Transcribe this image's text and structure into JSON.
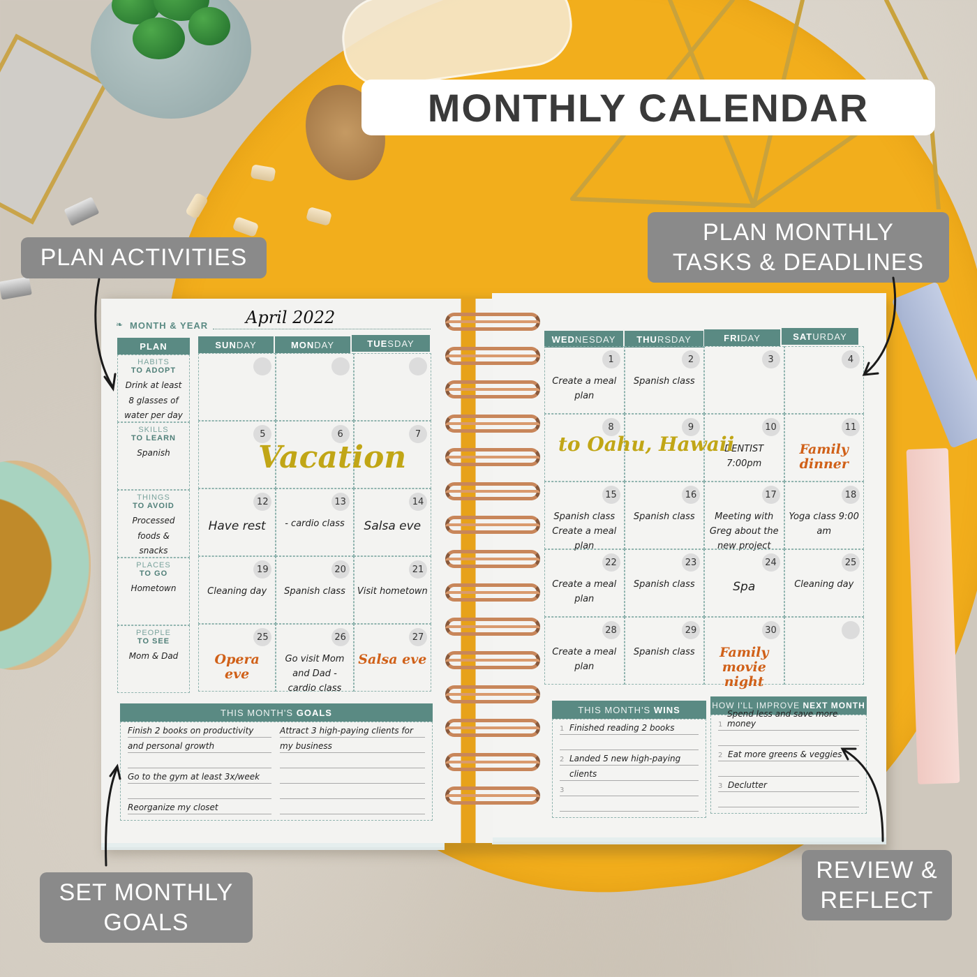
{
  "title": "MONTHLY CALENDAR",
  "callouts": {
    "plan_activities": "PLAN ACTIVITIES",
    "plan_monthly_line1": "PLAN MONTHLY",
    "plan_monthly_line2": "TASKS & DEADLINES",
    "set_goals_line1": "SET MONTHLY",
    "set_goals_line2": "GOALS",
    "review_line1": "REVIEW &",
    "review_line2": "REFLECT"
  },
  "planner": {
    "month_label": "MONTH & YEAR",
    "month_value": "April 2022",
    "plan_header": "PLAN",
    "plan": [
      {
        "category": "HABITS",
        "sub": "TO ADOPT",
        "value": "Drink at least 8 glasses of water per day"
      },
      {
        "category": "SKILLS",
        "sub": "TO LEARN",
        "value": "Spanish"
      },
      {
        "category": "THINGS",
        "sub": "TO AVOID",
        "value": "Processed foods & snacks"
      },
      {
        "category": "PLACES",
        "sub": "TO GO",
        "value": "Hometown"
      },
      {
        "category": "PEOPLE",
        "sub": "TO SEE",
        "value": "Mom & Dad"
      }
    ],
    "days": [
      {
        "bold": "SUN",
        "rest": "DAY"
      },
      {
        "bold": "MON",
        "rest": "DAY"
      },
      {
        "bold": "TUE",
        "rest": "SDAY"
      },
      {
        "bold": "WED",
        "rest": "NESDAY"
      },
      {
        "bold": "THU",
        "rest": "RSDAY"
      },
      {
        "bold": "FRI",
        "rest": "DAY"
      },
      {
        "bold": "SAT",
        "rest": "URDAY"
      }
    ],
    "weeks": [
      [
        {
          "n": "",
          "t": ""
        },
        {
          "n": "",
          "t": ""
        },
        {
          "n": "",
          "t": ""
        },
        {
          "n": "1",
          "t": "Create a meal plan"
        },
        {
          "n": "2",
          "t": "Spanish class"
        },
        {
          "n": "3",
          "t": ""
        },
        {
          "n": "4",
          "t": ""
        }
      ],
      [
        {
          "n": "5",
          "t": ""
        },
        {
          "n": "6",
          "t": ""
        },
        {
          "n": "7",
          "t": ""
        },
        {
          "n": "8",
          "t": ""
        },
        {
          "n": "9",
          "t": ""
        },
        {
          "n": "10",
          "t": "DENTIST 7:00pm"
        },
        {
          "n": "11",
          "t": "Family dinner",
          "style": "orange"
        }
      ],
      [
        {
          "n": "12",
          "t": "Have rest"
        },
        {
          "n": "13",
          "t": "- cardio class"
        },
        {
          "n": "14",
          "t": "Salsa eve"
        },
        {
          "n": "15",
          "t": "Spanish class Create a meal plan"
        },
        {
          "n": "16",
          "t": "Spanish class"
        },
        {
          "n": "17",
          "t": "Meeting with Greg about the new project"
        },
        {
          "n": "18",
          "t": "Yoga class 9:00 am"
        }
      ],
      [
        {
          "n": "19",
          "t": "Cleaning day"
        },
        {
          "n": "20",
          "t": "Spanish class"
        },
        {
          "n": "21",
          "t": "Visit hometown"
        },
        {
          "n": "22",
          "t": "Create a meal plan"
        },
        {
          "n": "23",
          "t": "Spanish class"
        },
        {
          "n": "24",
          "t": "Spa"
        },
        {
          "n": "25",
          "t": "Cleaning day"
        }
      ],
      [
        {
          "n": "25",
          "t": "Opera eve",
          "style": "orange"
        },
        {
          "n": "26",
          "t": "Go visit Mom and Dad - cardio class"
        },
        {
          "n": "27",
          "t": "Salsa eve",
          "style": "orange"
        },
        {
          "n": "28",
          "t": "Create a meal plan"
        },
        {
          "n": "29",
          "t": "Spanish class"
        },
        {
          "n": "30",
          "t": "Family movie night",
          "style": "orange"
        },
        {
          "n": "",
          "t": ""
        }
      ]
    ],
    "vacation_text": "Vacation",
    "oahu_text": "to Oahu, Hawaii",
    "goals": {
      "title_light": "THIS MONTH'S ",
      "title_bold": "GOALS",
      "left": [
        "Finish 2 books on productivity",
        "and personal growth",
        "",
        "Go to the gym at least 3x/week",
        "",
        "Reorganize my closet"
      ],
      "right": [
        "Attract 3 high-paying clients for",
        "my business",
        "",
        "",
        "",
        ""
      ]
    },
    "wins": {
      "title_light": "THIS MONTH'S ",
      "title_bold": "WINS",
      "lines": [
        {
          "idx": "1",
          "text": "Finished reading 2 books"
        },
        {
          "idx": "",
          "text": ""
        },
        {
          "idx": "2",
          "text": "Landed 5 new high-paying"
        },
        {
          "idx": "",
          "text": "clients"
        },
        {
          "idx": "3",
          "text": ""
        },
        {
          "idx": "",
          "text": ""
        }
      ]
    },
    "improve": {
      "title_light": "HOW I'LL IMPROVE ",
      "title_bold": "NEXT MONTH",
      "lines": [
        {
          "idx": "1",
          "text": "Spend less and save more money"
        },
        {
          "idx": "",
          "text": ""
        },
        {
          "idx": "2",
          "text": "Eat more greens & veggies"
        },
        {
          "idx": "",
          "text": ""
        },
        {
          "idx": "3",
          "text": "Declutter"
        },
        {
          "idx": "",
          "text": ""
        }
      ]
    }
  },
  "colors": {
    "teal": "#5a8a83",
    "yellow_pad": "#f2ae1c",
    "orange_ink": "#d06018",
    "gold_ink": "#c1a616",
    "callout_gray": "#8a8a8a"
  }
}
